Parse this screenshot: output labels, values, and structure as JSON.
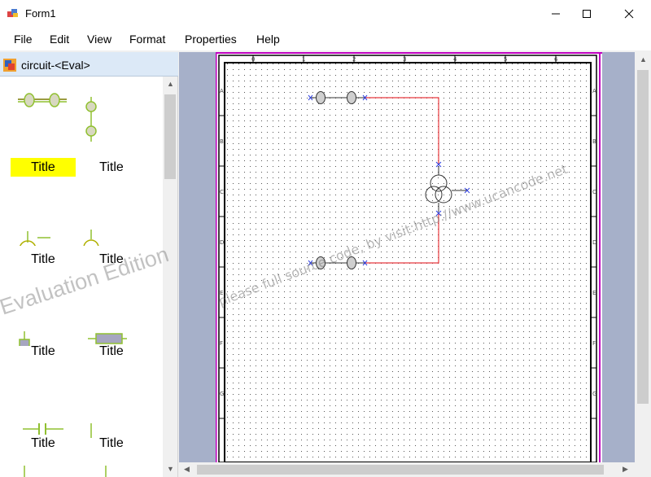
{
  "window": {
    "title": "Form1"
  },
  "menu": {
    "items": [
      {
        "label": "File"
      },
      {
        "label": "Edit"
      },
      {
        "label": "View"
      },
      {
        "label": "Format"
      },
      {
        "label": "Properties"
      },
      {
        "label": "Help"
      }
    ]
  },
  "panel": {
    "title": "circuit-<Eval>",
    "items": [
      {
        "label": "Title",
        "icon": "horizontal-resistor-pair-icon",
        "selected": true
      },
      {
        "label": "Title",
        "icon": "vertical-resistor-pair-icon",
        "selected": false
      },
      {
        "label": "Title",
        "icon": "three-winding-transformer-icon",
        "selected": false
      },
      {
        "label": "Title",
        "icon": "vertical-transformer-icon",
        "selected": false
      },
      {
        "label": "Title",
        "icon": "vertical-fuse-icon",
        "selected": false
      },
      {
        "label": "Title",
        "icon": "horizontal-fuse-icon",
        "selected": false
      },
      {
        "label": "Title",
        "icon": "horizontal-capacitor-icon",
        "selected": false
      },
      {
        "label": "Title",
        "icon": "vertical-capacitor-icon",
        "selected": false
      }
    ],
    "watermark": "Evaluation Edition"
  },
  "canvas": {
    "ruler_top": [
      "0",
      "1",
      "2",
      "3",
      "4",
      "5",
      "6"
    ],
    "ruler_left": [
      "A",
      "B",
      "C",
      "D",
      "E",
      "F",
      "G"
    ],
    "watermark": "please full source code, by visit:http://www.ucancode.net",
    "colors": {
      "wire": "#e8383d",
      "port": "#3040e0",
      "page_border": "#c000c0"
    }
  }
}
